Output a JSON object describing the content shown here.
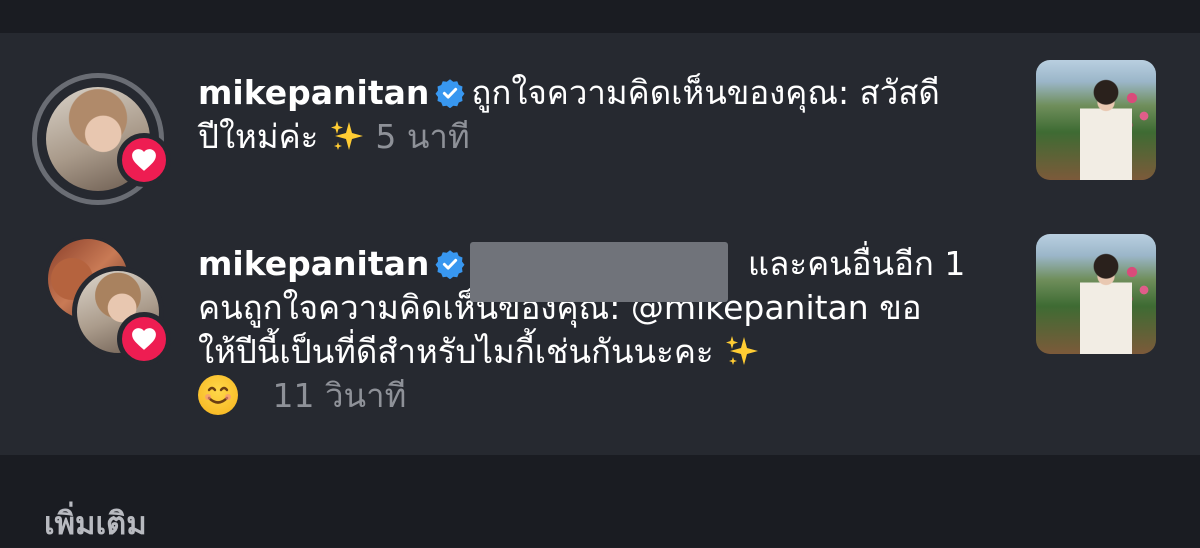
{
  "notifications": [
    {
      "username": "mikepanitan",
      "action_text": "ถูกใจความคิดเห็นของคุณ: สวัสดี",
      "action_text_line2": "ปีใหม่ค่ะ",
      "time": "5 นาที",
      "avatar_icon": "profile-avatar",
      "badge_icon": "heart-icon",
      "thumbnail_icon": "post-thumbnail"
    },
    {
      "username": "mikepanitan",
      "separator": ",",
      "redacted": true,
      "action_line1_tail": "และคนอื่นอีก 1",
      "action_line2": "คนถูกใจความคิดเห็นของคุณ: @mikepanitan ขอ",
      "action_line3": "ให้ปีนี้เป็นที่ดีสำหรับไมกี้เช่นกันนะคะ",
      "time": "11 วินาที",
      "avatar_icon": "stacked-profile-avatars",
      "badge_icon": "heart-icon",
      "thumbnail_icon": "post-thumbnail"
    }
  ],
  "footer": {
    "more_label": "เพิ่มเติม"
  },
  "colors": {
    "background": "#1c1e24",
    "panel": "#262930",
    "heart": "#ee1d52",
    "verified": "#3897f0",
    "secondary_text": "#8e9198"
  }
}
